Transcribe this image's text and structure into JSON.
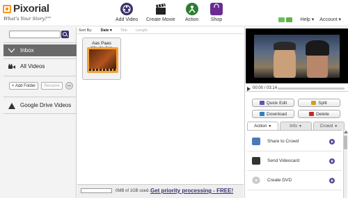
{
  "app": {
    "name": "Pixorial",
    "tagline": "What's Your Story?™"
  },
  "nav": [
    {
      "label": "Add Video",
      "icon": "film-reel-icon",
      "color": "#3d2f6b"
    },
    {
      "label": "Create Movie",
      "icon": "clapperboard-icon",
      "color": "#222222"
    },
    {
      "label": "Action",
      "icon": "action-icon",
      "color": "#2e7d32"
    },
    {
      "label": "Shop",
      "icon": "shopping-bag-icon",
      "color": "#6a2c91"
    }
  ],
  "header": {
    "help": "Help ▾",
    "account": "Account ▾"
  },
  "sidebar": {
    "search_placeholder": "",
    "items": [
      {
        "label": "Inbox",
        "icon": "inbox-icon"
      },
      {
        "label": "All Videos",
        "icon": "video-camera-icon"
      }
    ],
    "add_folder": "+ Add Folder",
    "rename": "Rename",
    "drive": {
      "label": "Google Drive Videos",
      "icon": "google-drive-icon"
    }
  },
  "main": {
    "sort": {
      "label": "Sort By:",
      "options": [
        "Date ▾",
        "Title",
        "Length"
      ],
      "selected": "Date"
    },
    "tile": {
      "title": "Aas Paas Khuda.3gp"
    },
    "footer": {
      "storage_text": "0MB of 1GB used.",
      "priority_link": "Get priority processing - FREE!",
      "storage_used_fraction": 0
    }
  },
  "player": {
    "time": "00:00 / 03:14",
    "progress": 0
  },
  "actions": {
    "quick_edit": "Quick Edit",
    "split": "Split",
    "download": "Download",
    "delete": "Delete"
  },
  "tabs": [
    {
      "label": "Action",
      "active": true
    },
    {
      "label": "Info",
      "active": false
    },
    {
      "label": "Crowd",
      "active": false
    }
  ],
  "action_items": [
    {
      "label": "Share to Crowd",
      "icon": "share-crowd-icon"
    },
    {
      "label": "Send Videocard",
      "icon": "videocard-icon"
    },
    {
      "label": "Create DVD",
      "icon": "dvd-icon"
    }
  ],
  "colors": {
    "brand": "#3d2f6b",
    "orange": "#f7941d",
    "sidebar_active": "#6a6a6a"
  }
}
